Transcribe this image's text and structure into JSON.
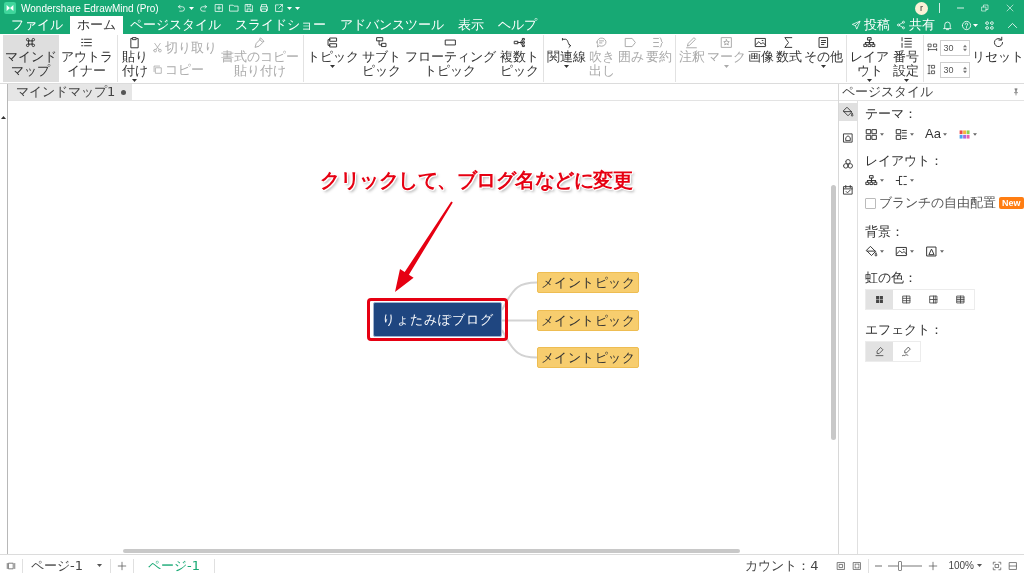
{
  "window": {
    "title": "Wondershare EdrawMind (Pro)",
    "avatar": "r"
  },
  "menu_tabs": [
    {
      "label": "ファイル",
      "selected": false
    },
    {
      "label": "ホーム",
      "selected": true
    },
    {
      "label": "ページスタイル",
      "selected": false
    },
    {
      "label": "スライドショー",
      "selected": false
    },
    {
      "label": "アドバンスツール",
      "selected": false
    },
    {
      "label": "表示",
      "selected": false
    },
    {
      "label": "ヘルプ",
      "selected": false
    }
  ],
  "header_actions": [
    {
      "label": "投稿"
    },
    {
      "label": "共有"
    }
  ],
  "ribbon": [
    {
      "items": [
        {
          "kind": "large",
          "label": "マインドマップ",
          "selected": true,
          "disabled": false,
          "dropdown": false
        },
        {
          "kind": "large",
          "label": "アウトライナー",
          "selected": false,
          "disabled": false,
          "dropdown": false
        }
      ]
    },
    {
      "items": [
        {
          "kind": "large",
          "label": "貼り付け",
          "disabled": false,
          "dropdown": true
        },
        {
          "kind": "small",
          "label": "切り取り",
          "disabled": true,
          "dropdown": false
        },
        {
          "kind": "small",
          "label": "コピー",
          "disabled": true,
          "dropdown": false
        },
        {
          "kind": "large",
          "label": "書式のコピー貼り付け",
          "disabled": true,
          "dropdown": false
        }
      ]
    },
    {
      "items": [
        {
          "kind": "large",
          "label": "トピック",
          "disabled": false,
          "dropdown": true
        },
        {
          "kind": "large",
          "label": "サブトピック",
          "disabled": false,
          "dropdown": false
        },
        {
          "kind": "large",
          "label": "フローティングトピック",
          "disabled": false,
          "dropdown": false
        },
        {
          "kind": "large",
          "label": "複数トピック",
          "disabled": false,
          "dropdown": false
        }
      ]
    },
    {
      "items": [
        {
          "kind": "large",
          "label": "関連線",
          "disabled": false,
          "dropdown": true
        },
        {
          "kind": "large",
          "label": "吹き出し",
          "disabled": true,
          "dropdown": false
        },
        {
          "kind": "large",
          "label": "囲み",
          "disabled": true,
          "dropdown": false
        },
        {
          "kind": "large",
          "label": "要約",
          "disabled": true,
          "dropdown": false
        }
      ]
    },
    {
      "items": [
        {
          "kind": "large",
          "label": "注釈",
          "disabled": true,
          "dropdown": false
        },
        {
          "kind": "large",
          "label": "マーク",
          "disabled": true,
          "dropdown": true
        },
        {
          "kind": "large",
          "label": "画像",
          "disabled": false,
          "dropdown": false
        },
        {
          "kind": "large",
          "label": "数式",
          "disabled": false,
          "dropdown": false
        },
        {
          "kind": "large",
          "label": "その他",
          "disabled": false,
          "dropdown": true
        }
      ]
    },
    {
      "items": [
        {
          "kind": "large",
          "label": "レイアウト",
          "disabled": false,
          "dropdown": true
        },
        {
          "kind": "large",
          "label": "番号設定",
          "disabled": false,
          "dropdown": true
        }
      ]
    },
    {
      "items": [
        {
          "kind": "spinner",
          "value": "30",
          "disabled": false
        },
        {
          "kind": "spinner",
          "value": "30",
          "disabled": false
        },
        {
          "kind": "large",
          "label": "リセット",
          "disabled": false,
          "dropdown": false
        }
      ]
    }
  ],
  "document_tabs": [
    {
      "label": "マインドマップ1",
      "selected": true,
      "modified": true
    }
  ],
  "canvas": {
    "annotation": "クリックして、ブログ名などに変更",
    "central_topic": {
      "label": "りょたみぽブログ",
      "highlighted": true
    },
    "main_topics": [
      {
        "label": "メイントピック"
      },
      {
        "label": "メイントピック"
      },
      {
        "label": "メイントピック"
      }
    ]
  },
  "side_panel": {
    "title": "ページスタイル",
    "tabs": [
      {
        "selected": true
      },
      {
        "selected": false
      },
      {
        "selected": false
      },
      {
        "selected": false
      }
    ],
    "sections": [
      {
        "kind": "dropdowns",
        "label": "テーマ：",
        "buttons": [
          {
            "kind": "icon",
            "dropdown": true
          },
          {
            "kind": "icon",
            "dropdown": true
          },
          {
            "kind": "text",
            "text": "Aa",
            "dropdown": true
          },
          {
            "kind": "icon",
            "dropdown": true
          }
        ]
      },
      {
        "kind": "dropdowns",
        "label": "レイアウト：",
        "buttons": [
          {
            "kind": "icon",
            "dropdown": true
          },
          {
            "kind": "icon",
            "dropdown": true
          }
        ],
        "checkbox": {
          "label": "ブランチの自由配置",
          "checked": false,
          "badge": "New"
        }
      },
      {
        "kind": "dropdowns",
        "label": "背景：",
        "buttons": [
          {
            "kind": "icon",
            "dropdown": true
          },
          {
            "kind": "icon",
            "dropdown": true
          },
          {
            "kind": "icon",
            "dropdown": true
          }
        ]
      },
      {
        "kind": "segments",
        "label": "虹の色：",
        "options": [
          {
            "selected": true
          },
          {
            "selected": false
          },
          {
            "selected": false
          },
          {
            "selected": false
          }
        ]
      },
      {
        "kind": "segments",
        "label": "エフェクト：",
        "options": [
          {
            "selected": true
          },
          {
            "selected": false
          }
        ]
      }
    ]
  },
  "status_bar": {
    "page_select": "ページ-1",
    "page_tabs": [
      {
        "label": "ページ-1",
        "selected": true
      }
    ],
    "count": "カウント：4",
    "zoom": {
      "level": 0.33,
      "reading": "100%"
    }
  }
}
